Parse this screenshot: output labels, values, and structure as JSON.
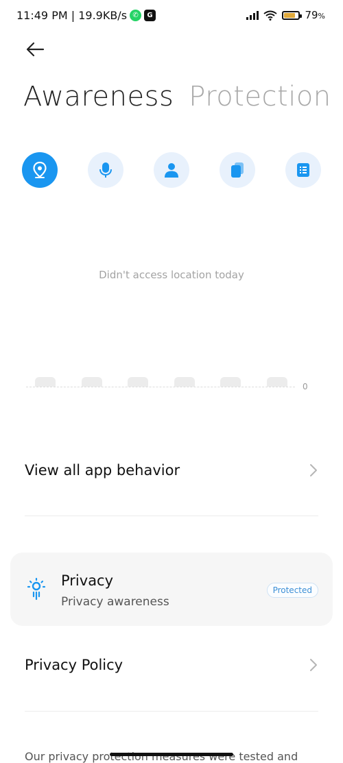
{
  "status_bar": {
    "time_speed": "11:49 PM | 19.9KB/s",
    "whatsapp_badge": "✆",
    "g_badge": "G",
    "battery_level": 0.79,
    "battery_text": "79",
    "battery_unit": "%",
    "battery_color": "#e0a93a"
  },
  "header": {
    "tabs": [
      {
        "label": "Awareness",
        "active": true
      },
      {
        "label": "Protection",
        "active": false
      }
    ]
  },
  "permissions": {
    "icons": [
      "location-icon",
      "microphone-icon",
      "contacts-icon",
      "clipboard-icon",
      "calendar-icon"
    ],
    "accent_color": "#1a96f0"
  },
  "chart_data": {
    "type": "bar",
    "categories": [
      "",
      "",
      "",
      "",
      "",
      ""
    ],
    "values": [
      0,
      0,
      0,
      0,
      0,
      0
    ],
    "y_tick_label": "0",
    "empty_message": "Didn't access location today"
  },
  "rows": {
    "app_behavior": "View all app behavior",
    "privacy_policy": "Privacy Policy"
  },
  "privacy_card": {
    "title": "Privacy",
    "subtitle": "Privacy awareness",
    "status": "Protected"
  },
  "footer": {
    "text": "Our privacy protection measures were tested and"
  }
}
